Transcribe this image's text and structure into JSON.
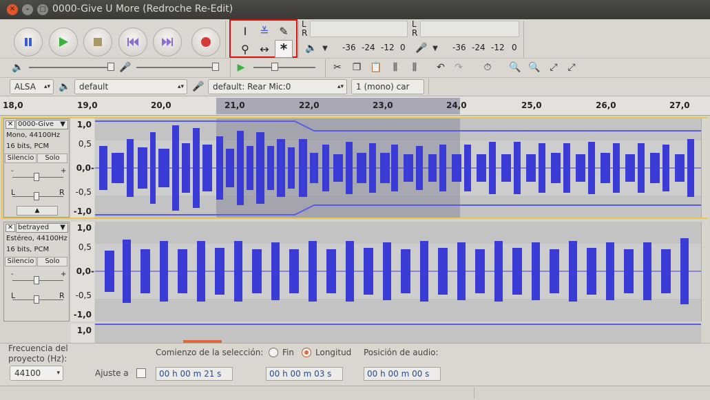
{
  "window": {
    "title": "0000-Give U More (Redroche Re-Edit)"
  },
  "transport": {
    "buttons": [
      "pause-button",
      "play-button",
      "stop-button",
      "skip-start-button",
      "skip-end-button",
      "record-button"
    ]
  },
  "meters": {
    "channels_top": [
      "L",
      "R"
    ],
    "channels_bottom": [
      "L",
      "R"
    ],
    "ticks": [
      "-36",
      "-24",
      "-12",
      "0"
    ]
  },
  "devices": {
    "host": "ALSA",
    "output": "default",
    "input": "default: Rear Mic:0",
    "channels": "1 (mono) car"
  },
  "ruler": {
    "ticks": [
      "18,0",
      "19,0",
      "20,0",
      "21,0",
      "22,0",
      "23,0",
      "24,0",
      "25,0",
      "26,0",
      "27,0"
    ]
  },
  "tracks": [
    {
      "name": "0000-Give",
      "info1": "Mono, 44100Hz",
      "info2": "16 bits, PCM",
      "mute": "Silencio",
      "solo": "Solo",
      "scale": [
        "1,0",
        "0,5",
        "0,0-",
        "-0,5",
        "-1,0"
      ]
    },
    {
      "name": "betrayed",
      "info1": "Estéreo, 44100Hz",
      "info2": "16 bits, PCM",
      "mute": "Silencio",
      "solo": "Solo",
      "scale": [
        "1,0",
        "0,5",
        "0,0-",
        "-0,5",
        "-1,0"
      ]
    }
  ],
  "third_scale": "1,0",
  "slider_labels": {
    "left": "L",
    "right": "R",
    "minus": "-",
    "plus": "+"
  },
  "bottom": {
    "rate_label": "Frecuencia del proyecto (Hz):",
    "rate_value": "44100",
    "snap_label": "Ajuste a",
    "selection_start_label": "Comienzo de la selección:",
    "end_label": "Fin",
    "length_label": "Longitud",
    "audio_position_label": "Posición de audio:",
    "selection_start": "00 h 00 m 21 s",
    "selection_length": "00 h 00 m 03 s",
    "audio_position": "00 h 00 m 00 s"
  },
  "colors": {
    "wave": "#3b3bd6",
    "selection": "#888899",
    "highlight_box": "#e01010"
  }
}
